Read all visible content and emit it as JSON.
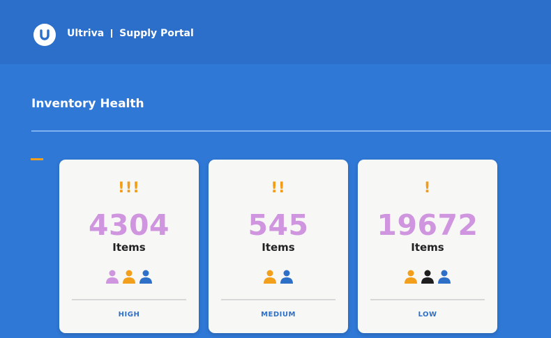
{
  "header": {
    "brand": "Ultriva",
    "portal": "Supply Portal"
  },
  "page": {
    "title": "Inventory Health"
  },
  "cards": [
    {
      "alert": "!!!",
      "count": "4304",
      "unit": "Items",
      "level": "HIGH",
      "people_icons": [
        "person-pink-icon",
        "person-orange-icon",
        "person-blue-icon"
      ]
    },
    {
      "alert": "!!",
      "count": "545",
      "unit": "Items",
      "level": "MEDIUM",
      "people_icons": [
        "person-orange-icon",
        "person-blue-icon"
      ]
    },
    {
      "alert": "!",
      "count": "19672",
      "unit": "Items",
      "level": "LOW",
      "people_icons": [
        "person-orange-icon",
        "person-black-icon",
        "person-blue-icon"
      ]
    }
  ],
  "colors": {
    "background": "#2f78d6",
    "header": "#2b6fcb",
    "accent_orange": "#f29d17",
    "count_pink": "#cf95de",
    "level_blue": "#2e6fc8",
    "person_pink": "#cf95de",
    "person_orange": "#f2a01c",
    "person_blue": "#2e6fc8",
    "person_black": "#1e1e1e"
  }
}
